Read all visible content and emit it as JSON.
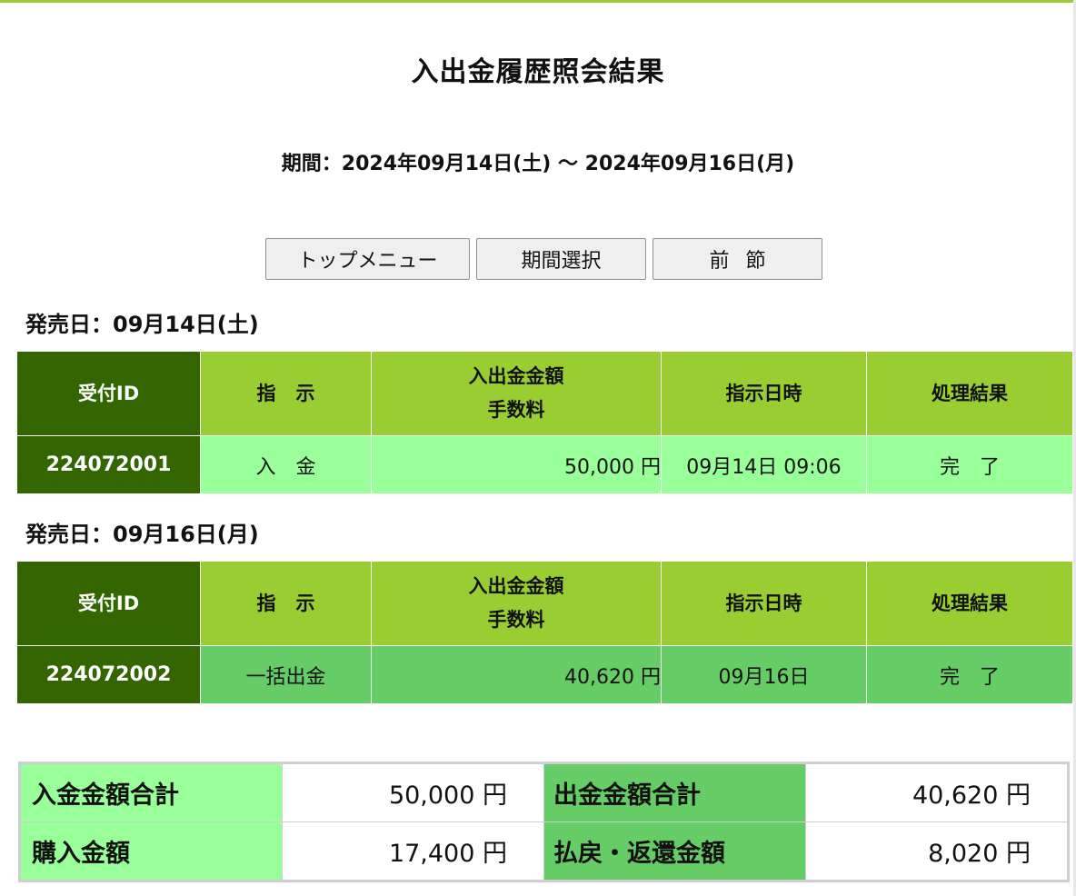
{
  "page": {
    "title": "入出金履歴照会結果",
    "period": "期間：2024年09月14日(土) 〜 2024年09月16日(月)"
  },
  "buttons": {
    "top_menu": "トップメニュー",
    "period_select": "期間選択",
    "previous": "前節"
  },
  "table_headers": {
    "id": "受付ID",
    "instruction": "指示",
    "amount_line1": "入出金金額",
    "amount_line2": "手数料",
    "datetime": "指示日時",
    "result": "処理結果"
  },
  "sections": [
    {
      "sale_date": "発売日：09月14日(土)",
      "rows": [
        {
          "id": "224072001",
          "instruction": "入金",
          "amount": "50,000 円",
          "datetime": "09月14日 09:06",
          "result": "完了"
        }
      ]
    },
    {
      "sale_date": "発売日：09月16日(月)",
      "rows": [
        {
          "id": "224072002",
          "instruction": "一括出金",
          "amount": "40,620 円",
          "datetime": "09月16日",
          "result": "完了"
        }
      ]
    }
  ],
  "summary": {
    "deposit_total_label": "入金金額合計",
    "deposit_total": "50,000 円",
    "withdraw_total_label": "出金金額合計",
    "withdraw_total": "40,620 円",
    "purchase_label": "購入金額",
    "purchase": "17,400 円",
    "refund_label": "払戻・返還金額",
    "refund": "8,020 円"
  },
  "colors": {
    "accent": "#9acd32",
    "dark_green": "#336600",
    "light_green": "#99ff99",
    "mid_green": "#66cc66"
  }
}
